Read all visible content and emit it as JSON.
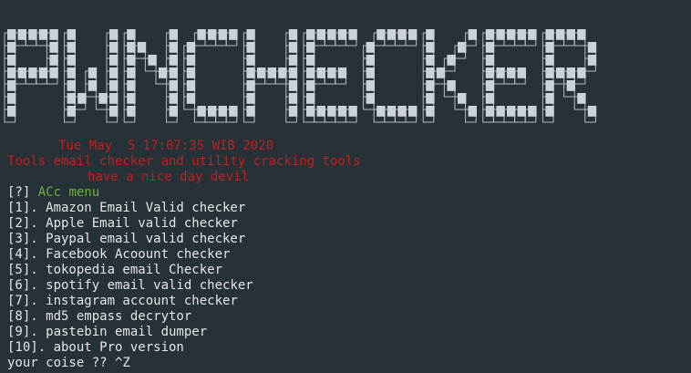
{
  "terminal": {
    "banner_text": "PWNCHECKER",
    "header": {
      "date_line": "Tue May  5 17:07:35 WIB 2020",
      "subtitle": "Tools email checker and utility cracking tools",
      "greeting": "have a nice day devil"
    },
    "menu": {
      "title_prefix": "[?]",
      "title_label": "ACc menu",
      "items": [
        "[1]. Amazon Email Valid checker",
        "[2]. Apple Email valid checker",
        "[3]. Paypal email valid checker",
        "[4]. Facebook Acoount checker",
        "[5]. tokopedia email Checker",
        "[6]. spotify email valid checker",
        "[7]. instagram account checker",
        "[8]. md5 empass decrytor",
        "[9]. pastebin email dumper",
        "[10]. about Pro version"
      ]
    },
    "prompt": "your coise ?? ^Z",
    "colors": {
      "background": "#263238",
      "banner_fill": "#ccd3d8",
      "header_text": "#c4201c",
      "menu_title": "#6cb33e",
      "text": "#e6e6e6"
    }
  }
}
